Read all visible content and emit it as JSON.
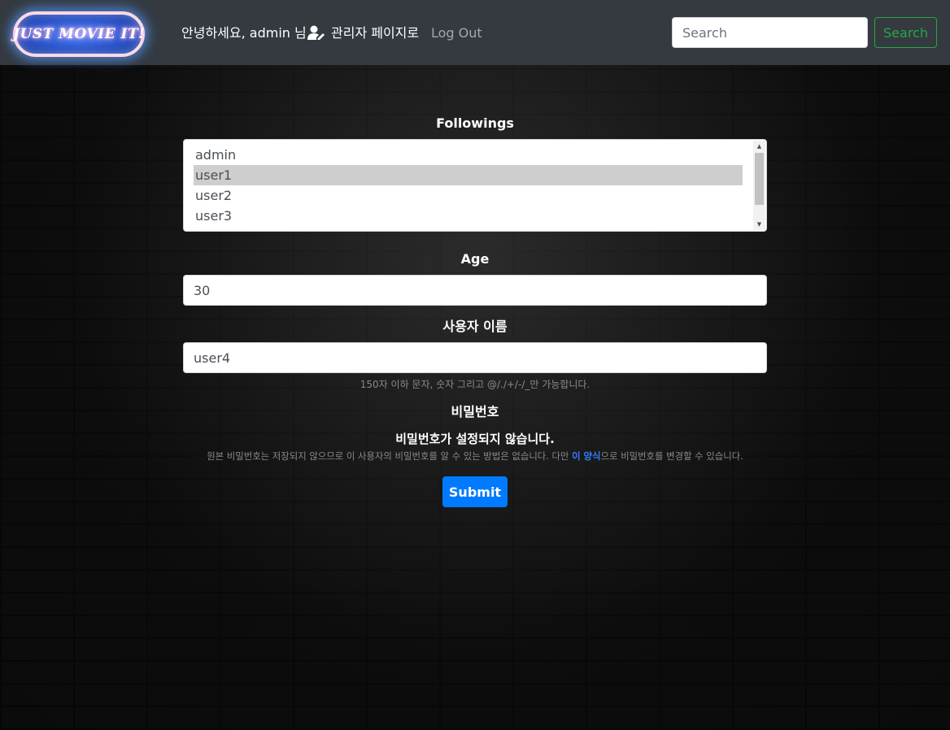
{
  "navbar": {
    "logo_text": "JUST MOVIE IT!",
    "greeting": "안녕하세요, admin 님",
    "admin_link": "관리자 페이지로",
    "logout": "Log Out",
    "search_placeholder": "Search",
    "search_button": "Search"
  },
  "form": {
    "followings": {
      "label": "Followings",
      "options": [
        {
          "label": "admin",
          "selected": false
        },
        {
          "label": "user1",
          "selected": true
        },
        {
          "label": "user2",
          "selected": false
        },
        {
          "label": "user3",
          "selected": false
        }
      ]
    },
    "age": {
      "label": "Age",
      "value": "30"
    },
    "username": {
      "label": "사용자 이름",
      "value": "user4",
      "help": "150자 이하 문자, 숫자 그리고 @/./+/-/_만 가능합니다."
    },
    "password": {
      "label": "비밀번호",
      "status": "비밀번호가 설정되지 않습니다.",
      "help_before": "원본 비밀번호는 저장되지 않으므로 이 사용자의 비밀번호를 알 수 있는 방법은 없습니다. 다만 ",
      "help_link": "이 양식",
      "help_after": "으로 비밀번호를 변경할 수 있습니다."
    },
    "submit": "Submit"
  },
  "colors": {
    "navbar_bg": "#343a40",
    "primary": "#007bff",
    "success": "#28a745"
  },
  "icons": [
    "user-edit-icon",
    "scroll-up-arrow-icon",
    "scroll-down-arrow-icon"
  ]
}
